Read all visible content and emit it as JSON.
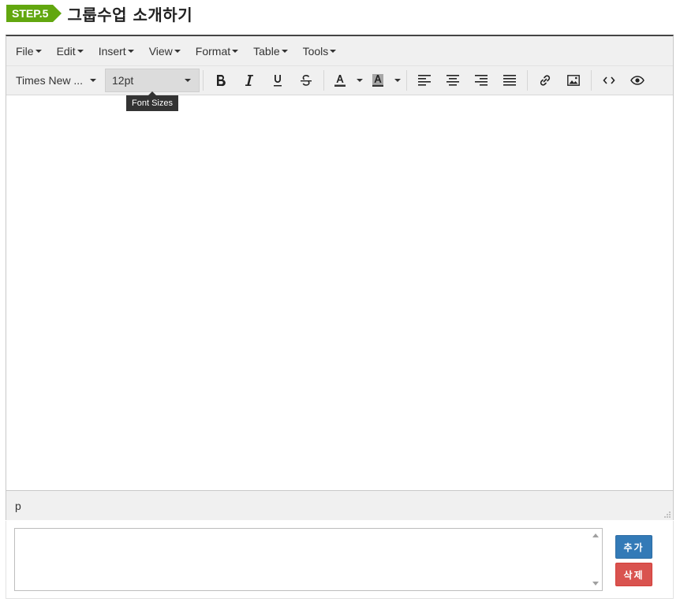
{
  "header": {
    "step_label": "STEP.5",
    "title": "그룹수업 소개하기"
  },
  "menubar": {
    "items": [
      {
        "label": "File"
      },
      {
        "label": "Edit"
      },
      {
        "label": "Insert"
      },
      {
        "label": "View"
      },
      {
        "label": "Format"
      },
      {
        "label": "Table"
      },
      {
        "label": "Tools"
      }
    ]
  },
  "toolbar": {
    "font_family": "Times New ...",
    "font_size": "12pt",
    "tooltip": "Font Sizes",
    "icons": [
      "bold-icon",
      "italic-icon",
      "underline-icon",
      "strikethrough-icon",
      "text-color-icon",
      "background-color-icon",
      "align-left-icon",
      "align-center-icon",
      "align-right-icon",
      "align-justify-icon",
      "link-icon",
      "image-icon",
      "source-code-icon",
      "preview-icon"
    ]
  },
  "statusbar": {
    "path": "p"
  },
  "form": {
    "textarea_value": "",
    "add_label": "추가",
    "delete_label": "삭제"
  },
  "colors": {
    "step_badge": "#62a70f",
    "add_button": "#337ab7",
    "delete_button": "#d9534f"
  }
}
